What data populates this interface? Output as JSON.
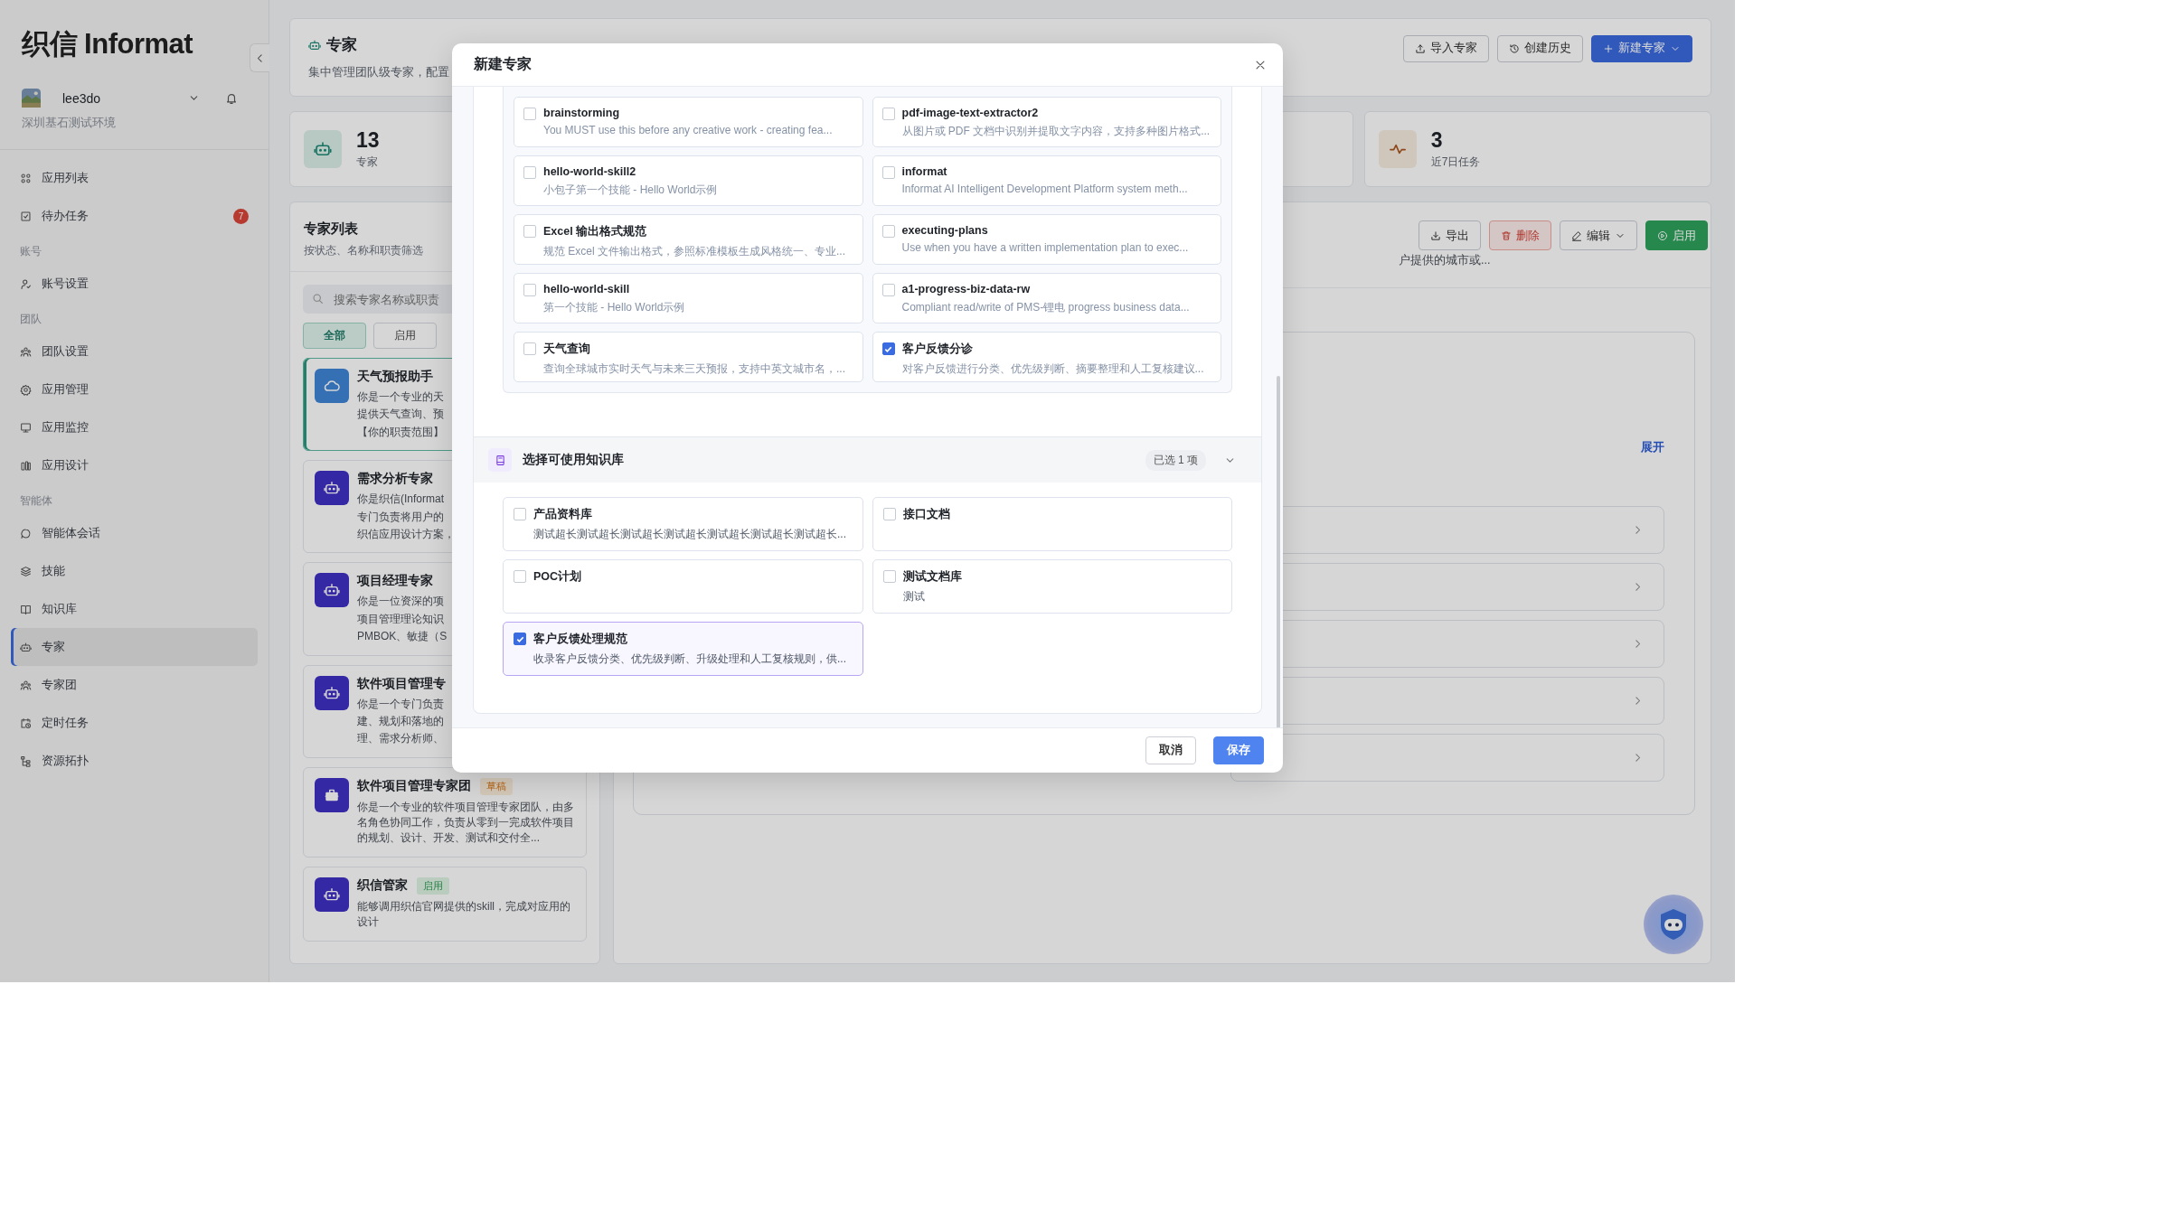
{
  "sidebar": {
    "logo": "织信 Informat",
    "user": {
      "name": "lee3do",
      "org": "深圳基石测试环境"
    },
    "nav": [
      {
        "kind": "item",
        "label": "应用列表",
        "selected": false
      },
      {
        "kind": "item",
        "label": "待办任务",
        "badge": "7",
        "selected": false
      },
      {
        "kind": "section",
        "label": "账号"
      },
      {
        "kind": "item",
        "label": "账号设置",
        "selected": false
      },
      {
        "kind": "section",
        "label": "团队"
      },
      {
        "kind": "item",
        "label": "团队设置",
        "selected": false
      },
      {
        "kind": "item",
        "label": "应用管理",
        "selected": false
      },
      {
        "kind": "item",
        "label": "应用监控",
        "selected": false
      },
      {
        "kind": "item",
        "label": "应用设计",
        "selected": false
      },
      {
        "kind": "section",
        "label": "智能体"
      },
      {
        "kind": "item",
        "label": "智能体会话",
        "selected": false
      },
      {
        "kind": "item",
        "label": "技能",
        "selected": false
      },
      {
        "kind": "item",
        "label": "知识库",
        "selected": false
      },
      {
        "kind": "item",
        "label": "专家",
        "selected": true
      },
      {
        "kind": "item",
        "label": "专家团",
        "selected": false
      },
      {
        "kind": "item",
        "label": "定时任务",
        "selected": false
      },
      {
        "kind": "item",
        "label": "资源拓扑",
        "selected": false
      }
    ]
  },
  "header": {
    "title": "专家",
    "subtitle": "集中管理团队级专家，配置",
    "buttons": [
      {
        "kind": "outline",
        "label": "导入专家"
      },
      {
        "kind": "outline",
        "label": "创建历史"
      },
      {
        "kind": "primary",
        "label": "新建专家"
      }
    ]
  },
  "stats": [
    {
      "value": "13",
      "label": "专家"
    },
    {
      "value": "3",
      "label": "近7日任务"
    }
  ],
  "expert_list": {
    "title": "专家列表",
    "subtitle": "按状态、名称和职责筛选",
    "search": {
      "placeholder": "搜索专家名称或职责"
    },
    "filters": [
      {
        "label": "全部",
        "selected": true
      },
      {
        "label": "启用",
        "selected": false
      }
    ],
    "experts": [
      {
        "kind": "weather",
        "name": "天气预报助手",
        "selected": true,
        "desc_lines": [
          "你是一个专业的天",
          "提供天气查询、预",
          "【你的职责范围】"
        ]
      },
      {
        "kind": "expert",
        "name": "需求分析专家",
        "selected": false,
        "desc_lines": [
          "你是织信(Informat",
          "专门负责将用户的",
          "织信应用设计方案，"
        ]
      },
      {
        "kind": "expert",
        "name": "项目经理专家",
        "selected": false,
        "desc_lines": [
          "你是一位资深的项",
          "项目管理理论知识",
          "PMBOK、敏捷（S"
        ]
      },
      {
        "kind": "expert",
        "name": "软件项目管理专",
        "selected": false,
        "desc_lines": [
          "你是一个专门负责",
          "建、规划和落地的",
          "理、需求分析师、"
        ]
      },
      {
        "kind": "team",
        "name": "软件项目管理专家团",
        "selected": false,
        "status": {
          "kind": "draft",
          "label": "草稿"
        },
        "desc_lines": [
          "你是一个专业的软件项目管理专家团队，由多名角色协同工作，负责从零到一完成软件项目的规划、设计、开发、测试和交付全..."
        ]
      },
      {
        "kind": "expert",
        "name": "织信管家",
        "selected": false,
        "status": {
          "kind": "enabled",
          "label": "启用"
        },
        "desc_lines": [
          "能够调用织信官网提供的skill，完成对应用的设计"
        ]
      }
    ]
  },
  "detail": {
    "buttons": [
      {
        "kind": "outline",
        "label": "导出"
      },
      {
        "kind": "danger",
        "label": "删除"
      },
      {
        "kind": "dropdown",
        "label": "编辑"
      },
      {
        "kind": "success",
        "label": "启用"
      }
    ],
    "summary": "户提供的城市或...",
    "expand_link": "展开"
  },
  "modal": {
    "title": "新建专家",
    "skills": [
      {
        "name": "brainstorming",
        "desc": "You MUST use this before any creative work - creating fea...",
        "checked": false
      },
      {
        "name": "pdf-image-text-extractor2",
        "desc": "从图片或 PDF 文档中识别并提取文字内容，支持多种图片格式...",
        "checked": false
      },
      {
        "name": "hello-world-skill2",
        "desc": "小包子第一个技能 - Hello World示例",
        "checked": false
      },
      {
        "name": "informat",
        "desc": "Informat AI Intelligent Development Platform system meth...",
        "checked": false
      },
      {
        "name": "Excel 输出格式规范",
        "desc": "规范 Excel 文件输出格式，参照标准模板生成风格统一、专业...",
        "checked": false
      },
      {
        "name": "executing-plans",
        "desc": "Use when you have a written implementation plan to exec...",
        "checked": false
      },
      {
        "name": "hello-world-skill",
        "desc": "第一个技能 - Hello World示例",
        "checked": false
      },
      {
        "name": "a1-progress-biz-data-rw",
        "desc": "Compliant read/write of PMS-锂电 progress business data...",
        "checked": false
      },
      {
        "name": "天气查询",
        "desc": "查询全球城市实时天气与未来三天预报，支持中英文城市名，...",
        "checked": false
      },
      {
        "name": "客户反馈分诊",
        "desc": "对客户反馈进行分类、优先级判断、摘要整理和人工复核建议...",
        "checked": true
      }
    ],
    "knowledge": {
      "title": "选择可使用知识库",
      "count": "已选 1 项",
      "items": [
        {
          "name": "产品资料库",
          "desc": "测试超长测试超长测试超长测试超长测试超长测试超长测试超长...",
          "checked": false
        },
        {
          "name": "接口文档",
          "checked": false
        },
        {
          "name": "POC计划",
          "checked": false
        },
        {
          "name": "测试文档库",
          "desc": "测试",
          "checked": false
        },
        {
          "name": "客户反馈处理规范",
          "desc": "收录客户反馈分类、优先级判断、升级处理和人工复核规则，供...",
          "checked": true
        }
      ]
    },
    "buttons": [
      {
        "kind": "secondary",
        "label": "取消"
      },
      {
        "kind": "primary",
        "label": "保存"
      }
    ]
  }
}
